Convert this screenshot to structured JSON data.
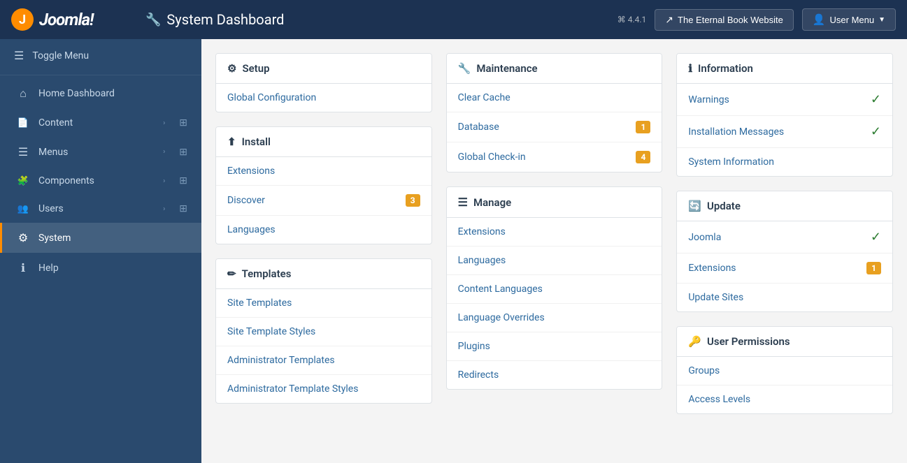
{
  "topbar": {
    "logo": "Joomla!",
    "title": "System Dashboard",
    "version": "⌘ 4.4.1",
    "site_button": "The Eternal Book Website",
    "user_button": "User Menu"
  },
  "sidebar": {
    "toggle_label": "Toggle Menu",
    "items": [
      {
        "id": "home-dashboard",
        "label": "Home Dashboard",
        "icon": "⌂",
        "has_arrow": false,
        "has_grid": false
      },
      {
        "id": "content",
        "label": "Content",
        "icon": "📄",
        "has_arrow": true,
        "has_grid": true
      },
      {
        "id": "menus",
        "label": "Menus",
        "icon": "☰",
        "has_arrow": true,
        "has_grid": true
      },
      {
        "id": "components",
        "label": "Components",
        "icon": "🧩",
        "has_arrow": true,
        "has_grid": true
      },
      {
        "id": "users",
        "label": "Users",
        "icon": "👥",
        "has_arrow": true,
        "has_grid": true
      },
      {
        "id": "system",
        "label": "System",
        "icon": "⚙",
        "has_arrow": false,
        "has_grid": false,
        "active": true
      },
      {
        "id": "help",
        "label": "Help",
        "icon": "ℹ",
        "has_arrow": false,
        "has_grid": false
      }
    ]
  },
  "panels": {
    "setup": {
      "header": "Setup",
      "header_icon": "⚙",
      "items": [
        {
          "label": "Global Configuration",
          "badge": null,
          "check": false
        }
      ]
    },
    "install": {
      "header": "Install",
      "header_icon": "⬆",
      "items": [
        {
          "label": "Extensions",
          "badge": null,
          "check": false
        },
        {
          "label": "Discover",
          "badge": "3",
          "check": false
        },
        {
          "label": "Languages",
          "badge": null,
          "check": false
        }
      ]
    },
    "templates": {
      "header": "Templates",
      "header_icon": "✏",
      "items": [
        {
          "label": "Site Templates",
          "badge": null,
          "check": false
        },
        {
          "label": "Site Template Styles",
          "badge": null,
          "check": false
        },
        {
          "label": "Administrator Templates",
          "badge": null,
          "check": false
        },
        {
          "label": "Administrator Template Styles",
          "badge": null,
          "check": false
        }
      ]
    },
    "maintenance": {
      "header": "Maintenance",
      "header_icon": "🔧",
      "items": [
        {
          "label": "Clear Cache",
          "badge": null,
          "check": false
        },
        {
          "label": "Database",
          "badge": "1",
          "check": false
        },
        {
          "label": "Global Check-in",
          "badge": "4",
          "check": false
        }
      ]
    },
    "manage": {
      "header": "Manage",
      "header_icon": "☰",
      "items": [
        {
          "label": "Extensions",
          "badge": null,
          "check": false
        },
        {
          "label": "Languages",
          "badge": null,
          "check": false
        },
        {
          "label": "Content Languages",
          "badge": null,
          "check": false
        },
        {
          "label": "Language Overrides",
          "badge": null,
          "check": false
        },
        {
          "label": "Plugins",
          "badge": null,
          "check": false
        },
        {
          "label": "Redirects",
          "badge": null,
          "check": false
        }
      ]
    },
    "information": {
      "header": "Information",
      "header_icon": "ℹ",
      "items": [
        {
          "label": "Warnings",
          "badge": null,
          "check": true
        },
        {
          "label": "Installation Messages",
          "badge": null,
          "check": true
        },
        {
          "label": "System Information",
          "badge": null,
          "check": false
        }
      ]
    },
    "update": {
      "header": "Update",
      "header_icon": "🔄",
      "items": [
        {
          "label": "Joomla",
          "badge": null,
          "check": true
        },
        {
          "label": "Extensions",
          "badge": "1",
          "check": false
        },
        {
          "label": "Update Sites",
          "badge": null,
          "check": false
        }
      ]
    },
    "user_permissions": {
      "header": "User Permissions",
      "header_icon": "🔑",
      "items": [
        {
          "label": "Groups",
          "badge": null,
          "check": false
        },
        {
          "label": "Access Levels",
          "badge": null,
          "check": false
        }
      ]
    }
  }
}
